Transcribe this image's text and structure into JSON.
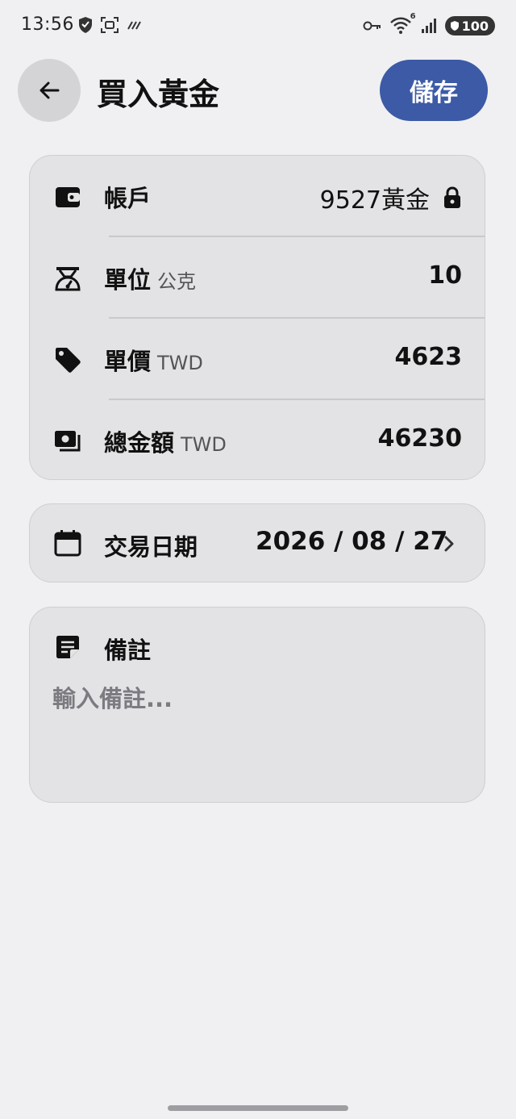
{
  "status_bar": {
    "time": "13:56",
    "battery": "100",
    "network_badge": "6"
  },
  "header": {
    "title": "買入黃金",
    "save_label": "儲存"
  },
  "details": {
    "account": {
      "label": "帳戶",
      "value": "9527黃金"
    },
    "unit": {
      "label": "單位",
      "unit": "公克",
      "value": "10"
    },
    "unit_price": {
      "label": "單價",
      "unit": "TWD",
      "value": "4623"
    },
    "total": {
      "label": "總金額",
      "unit": "TWD",
      "value": "46230"
    }
  },
  "trade_date": {
    "label": "交易日期",
    "value": "2026 / 08 / 27"
  },
  "note": {
    "label": "備註",
    "placeholder": "輸入備註..."
  },
  "icons": {
    "back": "arrow-left-icon",
    "account": "wallet-icon",
    "lock": "lock-icon",
    "unit": "scale-icon",
    "price": "tag-icon",
    "total": "cash-icon",
    "date": "calendar-icon",
    "chevron": "chevron-right-icon",
    "note": "sticky-note-icon"
  },
  "colors": {
    "background": "#f0f0f3",
    "card": "#e3e3e6",
    "accent": "#3c5aa6",
    "placeholder": "#7b7b80"
  }
}
